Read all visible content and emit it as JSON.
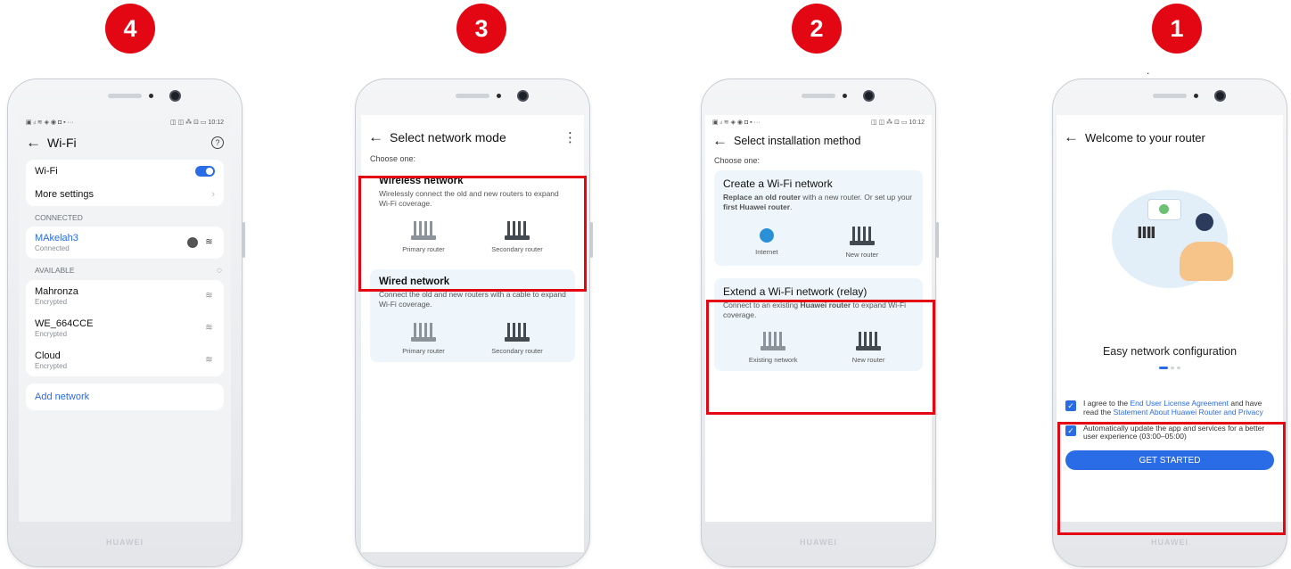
{
  "accent_red": "#e30613",
  "accent_blue": "#2a6be6",
  "steps": [
    "4",
    "3",
    "2",
    "1"
  ],
  "brand": "HUAWEI",
  "phone4": {
    "status_left": "▣ ᵢₗ ≋ ◈ ◉ ◘ ▪ ···",
    "status_right": "◫ ◫ ⁂ ⊡ ▭ 10:12",
    "title": "Wi-Fi",
    "help_icon": "?",
    "wifi_label": "Wi-Fi",
    "more_settings": "More settings",
    "connected_header": "CONNECTED",
    "connected": {
      "name": "MAkelah3",
      "status": "Connected"
    },
    "available_header": "AVAILABLE",
    "available": [
      {
        "name": "Mahronza",
        "status": "Encrypted"
      },
      {
        "name": "WE_664CCE",
        "status": "Encrypted"
      },
      {
        "name": "Cloud",
        "status": "Encrypted"
      }
    ],
    "add_network": "Add network"
  },
  "phone3": {
    "title": "Select network mode",
    "choose": "Choose one:",
    "wireless": {
      "title": "Wireless network",
      "desc": "Wirelessly connect the old and new routers to expand Wi-Fi coverage.",
      "left": "Primary router",
      "right": "Secondary router"
    },
    "wired": {
      "title": "Wired network",
      "desc": "Connect the old and new routers with a cable to expand Wi-Fi coverage.",
      "left": "Primary router",
      "right": "Secondary router"
    }
  },
  "phone2": {
    "status_left": "▣ ᵢₗ ≋ ◈ ◉ ◘ ▪ ···",
    "status_right": "◫ ◫ ⁂ ⊡ ▭ 10:12",
    "title": "Select installation method",
    "choose": "Choose one:",
    "create": {
      "title": "Create a Wi-Fi network",
      "desc_a": "Replace an old router",
      "desc_b": " with a new router. Or set up your ",
      "desc_c": "first Huawei router",
      "desc_d": ".",
      "left": "Internet",
      "right": "New router"
    },
    "extend": {
      "title": "Extend a Wi-Fi network (relay)",
      "desc_a": "Connect to an existing ",
      "desc_b": "Huawei router",
      "desc_c": " to expand Wi-Fi coverage.",
      "left": "Existing network",
      "right": "New router"
    }
  },
  "phone1": {
    "dot": ".",
    "title": "Welcome to your router",
    "caption": "Easy network configuration",
    "agree1_a": "I agree to the ",
    "agree1_link1": "End User License Agreement",
    "agree1_b": " and have read the ",
    "agree1_link2": "Statement About Huawei Router and Privacy",
    "agree2": "Automatically update the app and services for a better user experience (03:00–05:00)",
    "button": "GET STARTED"
  }
}
